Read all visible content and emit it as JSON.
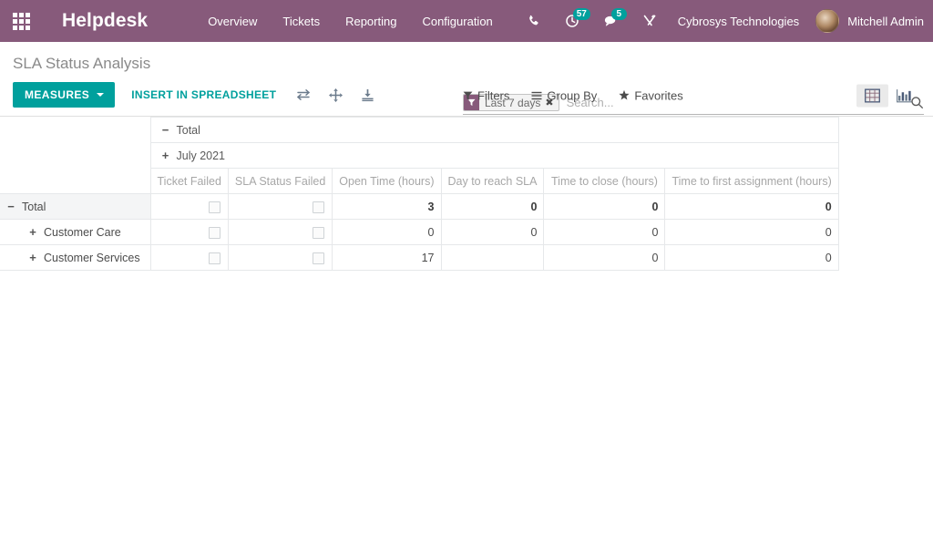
{
  "navbar": {
    "apps_icon": "apps-grid-icon",
    "brand": "Helpdesk",
    "menu": [
      {
        "label": "Overview"
      },
      {
        "label": "Tickets"
      },
      {
        "label": "Reporting"
      },
      {
        "label": "Configuration"
      }
    ],
    "sysicons": [
      {
        "name": "phone-icon",
        "badge": ""
      },
      {
        "name": "activity-clock-icon",
        "badge": "57"
      },
      {
        "name": "messages-icon",
        "badge": "5"
      },
      {
        "name": "tools-icon",
        "badge": ""
      }
    ],
    "company": "Cybrosys Technologies",
    "user": "Mitchell Admin",
    "colors": {
      "bar": "#875A7B",
      "badge": "#00A09D"
    }
  },
  "control_panel": {
    "breadcrumb": "SLA Status Analysis",
    "measures_label": "MEASURES",
    "insert_spreadsheet_label": "INSERT IN SPREADSHEET",
    "icons": [
      {
        "name": "flip-axis-icon"
      },
      {
        "name": "expand-all-icon"
      },
      {
        "name": "download-xlsx-icon"
      }
    ],
    "search": {
      "facet_label": "Last 7 days",
      "facet_close": "✖",
      "placeholder": "Search..."
    },
    "dropdowns": [
      {
        "label": "Filters",
        "icon": "filter-icon"
      },
      {
        "label": "Group By",
        "icon": "bars-icon"
      },
      {
        "label": "Favorites",
        "icon": "star-icon"
      }
    ],
    "views": [
      {
        "name": "pivot-view-icon",
        "active": true
      },
      {
        "name": "bar-chart-view-icon",
        "active": false
      }
    ],
    "accent": "#00A09D"
  },
  "pivot": {
    "col_total_label": "Total",
    "col_total_toggle": "−",
    "col_group_label": "July 2021",
    "col_group_toggle": "+",
    "measures": [
      "Ticket Failed",
      "SLA Status Failed",
      "Open Time (hours)",
      "Day to reach SLA",
      "Time to close (hours)",
      "Time to first assignment (hours)"
    ],
    "rows": [
      {
        "label": "Total",
        "toggle": "−",
        "indent": 0,
        "is_total": true,
        "cells": [
          {
            "type": "checkbox",
            "value": ""
          },
          {
            "type": "checkbox",
            "value": ""
          },
          {
            "type": "number",
            "value": "3"
          },
          {
            "type": "number",
            "value": "0"
          },
          {
            "type": "number",
            "value": "0"
          },
          {
            "type": "number",
            "value": "0"
          }
        ]
      },
      {
        "label": "Customer Care",
        "toggle": "+",
        "indent": 1,
        "is_total": false,
        "cells": [
          {
            "type": "checkbox",
            "value": ""
          },
          {
            "type": "checkbox",
            "value": ""
          },
          {
            "type": "number",
            "value": "0"
          },
          {
            "type": "number",
            "value": "0"
          },
          {
            "type": "number",
            "value": "0"
          },
          {
            "type": "number",
            "value": "0"
          }
        ]
      },
      {
        "label": "Customer Services",
        "toggle": "+",
        "indent": 1,
        "is_total": false,
        "cells": [
          {
            "type": "checkbox",
            "value": ""
          },
          {
            "type": "checkbox",
            "value": ""
          },
          {
            "type": "number",
            "value": "17"
          },
          {
            "type": "empty",
            "value": ""
          },
          {
            "type": "number",
            "value": "0"
          },
          {
            "type": "number",
            "value": "0"
          }
        ]
      }
    ]
  }
}
